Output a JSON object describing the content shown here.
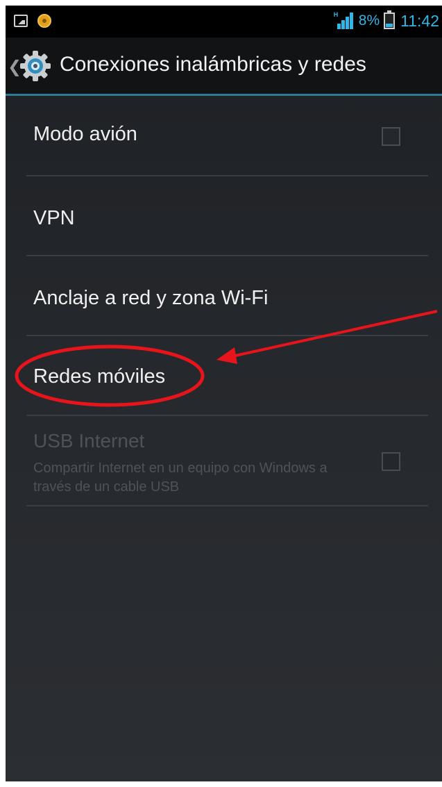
{
  "status_bar": {
    "network_tag": "H",
    "battery_percent": "8%",
    "time": "11:42"
  },
  "action_bar": {
    "title": "Conexiones inalámbricas y redes"
  },
  "settings": [
    {
      "label": "Modo avión",
      "has_checkbox": true,
      "checked": false,
      "enabled": true
    },
    {
      "label": "VPN",
      "enabled": true
    },
    {
      "label": "Anclaje a red y zona Wi-Fi",
      "enabled": true
    },
    {
      "label": "Redes móviles",
      "enabled": true,
      "highlighted": true
    },
    {
      "label": "USB Internet",
      "summary": "Compartir Internet en un equipo con Windows a través de un cable USB",
      "has_checkbox": true,
      "checked": false,
      "enabled": false
    }
  ],
  "colors": {
    "accent": "#33b5e5",
    "annotation": "#e8141c"
  },
  "icons": {
    "status_left": [
      "image-icon",
      "notification-icon"
    ],
    "action_bar": "settings-gear-icon"
  }
}
